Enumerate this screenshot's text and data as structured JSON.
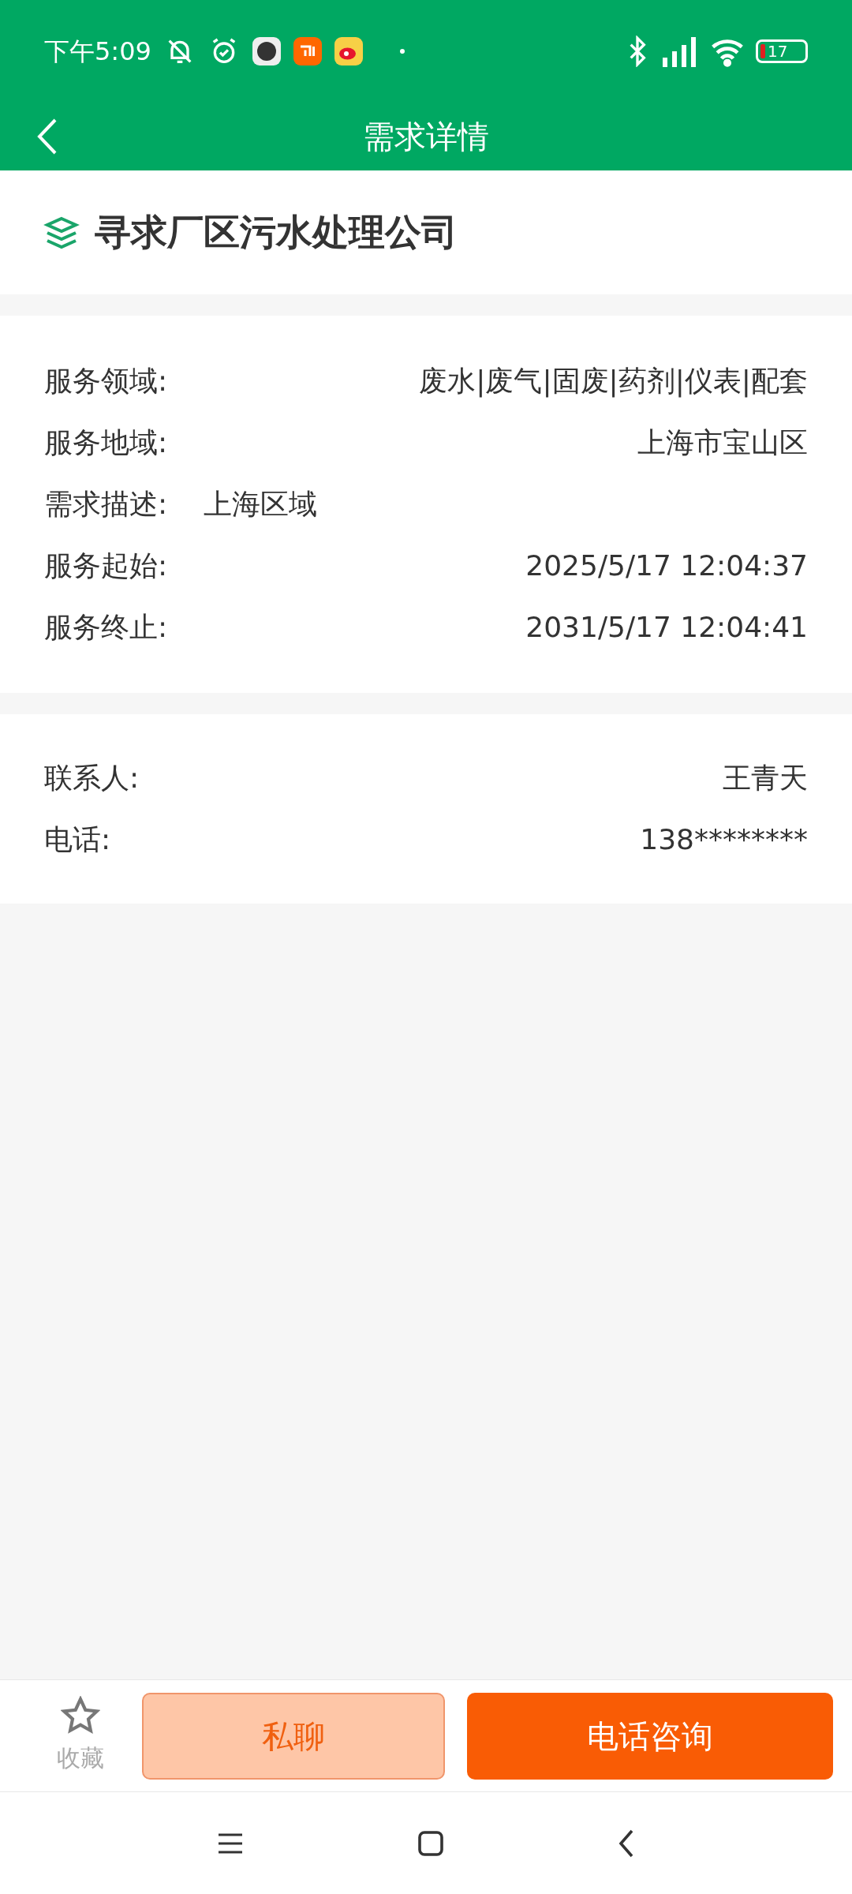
{
  "status_bar": {
    "time": "下午5:09",
    "battery": "17"
  },
  "header": {
    "title": "需求详情"
  },
  "demand": {
    "title": "寻求厂区污水处理公司"
  },
  "details": [
    {
      "kind": "split",
      "label": "服务领域:",
      "value": "废水|废气|固废|药剂|仪表|配套"
    },
    {
      "kind": "split",
      "label": "服务地域:",
      "value": "上海市宝山区"
    },
    {
      "kind": "inline",
      "label": "需求描述:",
      "value": "上海区域"
    },
    {
      "kind": "split",
      "label": "服务起始:",
      "value": "2025/5/17 12:04:37"
    },
    {
      "kind": "split",
      "label": "服务终止:",
      "value": "2031/5/17 12:04:41"
    }
  ],
  "contact": [
    {
      "kind": "split",
      "label": "联系人:",
      "value": "王青天"
    },
    {
      "kind": "split",
      "label": "电话:",
      "value": "138********"
    }
  ],
  "bottom_bar": {
    "favorite": {
      "label": "收藏",
      "selected": false
    },
    "chat_button": "私聊",
    "call_button": "电话咨询"
  }
}
